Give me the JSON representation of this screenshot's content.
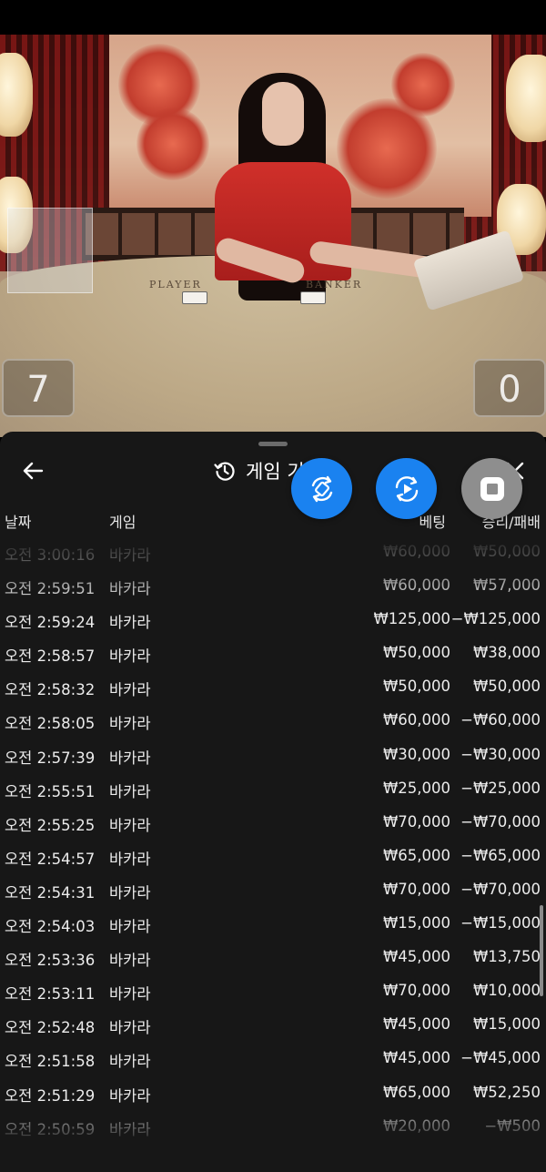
{
  "panel": {
    "title": "게임 기",
    "columns": {
      "date": "날짜",
      "game": "게임",
      "bet": "베팅",
      "result": "승리/패배"
    },
    "rows": [
      {
        "date": "오전 3:00:16",
        "game": "바카라",
        "bet": "₩60,000",
        "result": "₩50,000"
      },
      {
        "date": "오전 2:59:51",
        "game": "바카라",
        "bet": "₩60,000",
        "result": "₩57,000"
      },
      {
        "date": "오전 2:59:24",
        "game": "바카라",
        "bet": "₩125,000",
        "result": "−₩125,000"
      },
      {
        "date": "오전 2:58:57",
        "game": "바카라",
        "bet": "₩50,000",
        "result": "₩38,000"
      },
      {
        "date": "오전 2:58:32",
        "game": "바카라",
        "bet": "₩50,000",
        "result": "₩50,000"
      },
      {
        "date": "오전 2:58:05",
        "game": "바카라",
        "bet": "₩60,000",
        "result": "−₩60,000"
      },
      {
        "date": "오전 2:57:39",
        "game": "바카라",
        "bet": "₩30,000",
        "result": "−₩30,000"
      },
      {
        "date": "오전 2:55:51",
        "game": "바카라",
        "bet": "₩25,000",
        "result": "−₩25,000"
      },
      {
        "date": "오전 2:55:25",
        "game": "바카라",
        "bet": "₩70,000",
        "result": "−₩70,000"
      },
      {
        "date": "오전 2:54:57",
        "game": "바카라",
        "bet": "₩65,000",
        "result": "−₩65,000"
      },
      {
        "date": "오전 2:54:31",
        "game": "바카라",
        "bet": "₩70,000",
        "result": "−₩70,000"
      },
      {
        "date": "오전 2:54:03",
        "game": "바카라",
        "bet": "₩15,000",
        "result": "−₩15,000"
      },
      {
        "date": "오전 2:53:36",
        "game": "바카라",
        "bet": "₩45,000",
        "result": "₩13,750"
      },
      {
        "date": "오전 2:53:11",
        "game": "바카라",
        "bet": "₩70,000",
        "result": "₩10,000"
      },
      {
        "date": "오전 2:52:48",
        "game": "바카라",
        "bet": "₩45,000",
        "result": "₩15,000"
      },
      {
        "date": "오전 2:51:58",
        "game": "바카라",
        "bet": "₩45,000",
        "result": "−₩45,000"
      },
      {
        "date": "오전 2:51:29",
        "game": "바카라",
        "bet": "₩65,000",
        "result": "₩52,250"
      },
      {
        "date": "오전 2:50:59",
        "game": "바카라",
        "bet": "₩20,000",
        "result": "−₩500"
      }
    ]
  },
  "video": {
    "table_labels": {
      "player": "PLAYER",
      "banker": "BANKER"
    },
    "scores": {
      "left": "7",
      "right": "0"
    }
  },
  "icons": {
    "back": "arrow-left-icon",
    "history": "history-clock-icon",
    "close": "close-x-icon",
    "fab1": "rotate-screen-icon",
    "fab2": "replay-video-icon",
    "fab3": "stop-record-icon"
  },
  "colors": {
    "panel_bg": "#171717",
    "fab_blue": "#1a82f0",
    "fab_gray": "#8e8e8e"
  }
}
